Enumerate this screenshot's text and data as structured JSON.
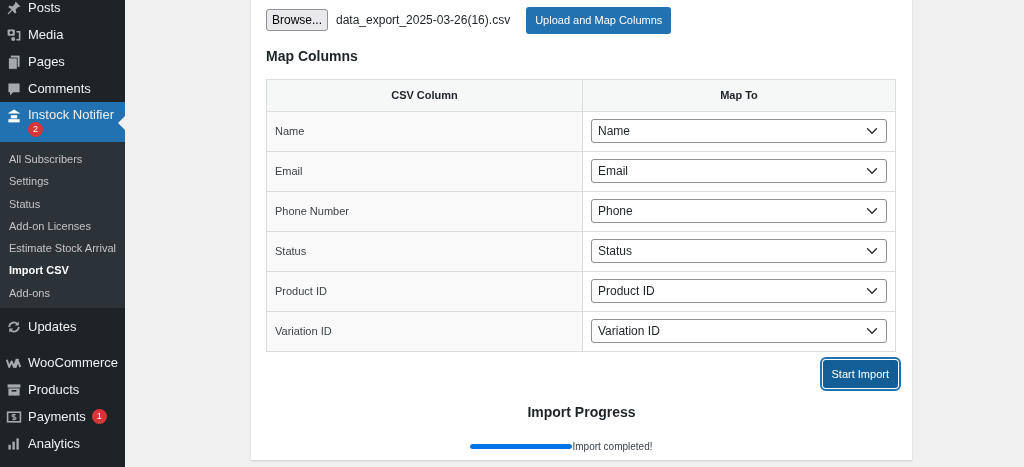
{
  "sidebar": {
    "items": [
      {
        "label": "Posts",
        "selected": false
      },
      {
        "label": "Media",
        "selected": false
      },
      {
        "label": "Pages",
        "selected": false
      },
      {
        "label": "Comments",
        "selected": false
      },
      {
        "label": "Instock Notifier",
        "selected": true,
        "badge": "2",
        "children": [
          {
            "label": "All Subscribers",
            "selected": false
          },
          {
            "label": "Settings",
            "selected": false
          },
          {
            "label": "Status",
            "selected": false
          },
          {
            "label": "Add-on Licenses",
            "selected": false
          },
          {
            "label": "Estimate Stock Arrival",
            "selected": false
          },
          {
            "label": "Import CSV",
            "selected": true
          },
          {
            "label": "Add-ons",
            "selected": false
          }
        ]
      },
      {
        "label": "Updates",
        "selected": false
      },
      {
        "label": "WooCommerce",
        "selected": false
      },
      {
        "label": "Products",
        "selected": false
      },
      {
        "label": "Payments",
        "selected": false,
        "badge": "1"
      },
      {
        "label": "Analytics",
        "selected": false
      }
    ]
  },
  "file_upload": {
    "browse_button": "Browse...",
    "filename": "data_export_2025-03-26(16).csv",
    "upload_button": "Upload and Map Columns"
  },
  "map_columns": {
    "title": "Map Columns",
    "columns": [
      "CSV Column",
      "Map To"
    ],
    "rows": [
      {
        "csv_column": "Name",
        "map_to": "Name"
      },
      {
        "csv_column": "Email",
        "map_to": "Email"
      },
      {
        "csv_column": "Phone Number",
        "map_to": "Phone"
      },
      {
        "csv_column": "Status",
        "map_to": "Status"
      },
      {
        "csv_column": "Product ID",
        "map_to": "Product ID"
      },
      {
        "csv_column": "Variation ID",
        "map_to": "Variation ID"
      }
    ]
  },
  "start_button": "Start Import",
  "progress": {
    "title": "Import Progress",
    "level": 1,
    "message": "Import completed!"
  }
}
